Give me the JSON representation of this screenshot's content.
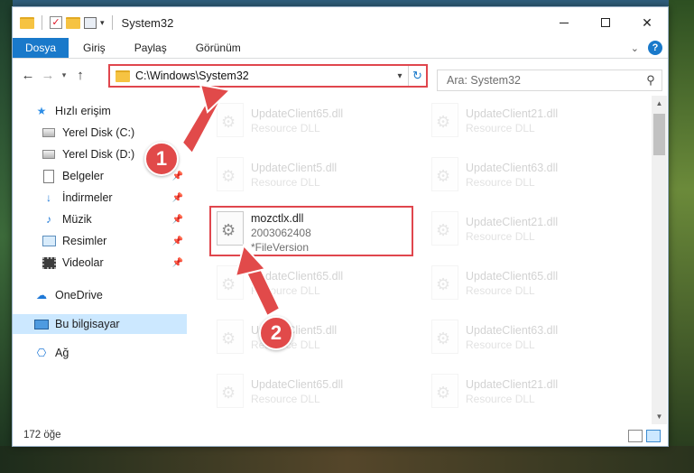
{
  "window": {
    "title": "System32",
    "minimize_label": "",
    "close_glyph": "✕"
  },
  "ribbon": {
    "tabs": [
      "Dosya",
      "Giriş",
      "Paylaş",
      "Görünüm"
    ],
    "help_glyph": "?",
    "expand_glyph": "⌄"
  },
  "address": {
    "path": "C:\\Windows\\System32",
    "refresh_glyph": "↻",
    "search_placeholder": "Ara: System32"
  },
  "nav_pane": {
    "items": [
      {
        "label": "Hızlı erişim",
        "icon": "star-icon"
      },
      {
        "label": "Yerel Disk (C:)",
        "icon": "disk-icon"
      },
      {
        "label": "Yerel Disk (D:)",
        "icon": "disk-icon"
      },
      {
        "label": "Belgeler",
        "icon": "document-icon"
      },
      {
        "label": "İndirmeler",
        "icon": "download-icon"
      },
      {
        "label": "Müzik",
        "icon": "music-icon"
      },
      {
        "label": "Resimler",
        "icon": "pictures-icon"
      },
      {
        "label": "Videolar",
        "icon": "video-icon"
      },
      {
        "label": "OneDrive",
        "icon": "cloud-icon"
      },
      {
        "label": "Bu bilgisayar",
        "icon": "computer-icon"
      },
      {
        "label": "Ağ",
        "icon": "network-icon"
      }
    ]
  },
  "files": {
    "col1": [
      {
        "name": "UpdateClient65.dll",
        "sub": "Resource DLL"
      },
      {
        "name": "UpdateClient5.dll",
        "sub": "Resource DLL"
      },
      {
        "name": "mozctlx.dll",
        "sub": "2003062408",
        "sub2": "*FileVersion"
      },
      {
        "name": "UpdateClient65.dll",
        "sub": "Resource DLL"
      },
      {
        "name": "UpdateClient5.dll",
        "sub": "Resource DLL"
      },
      {
        "name": "UpdateClient65.dll",
        "sub": "Resource DLL"
      }
    ],
    "col2": [
      {
        "name": "UpdateClient21.dll",
        "sub": "Resource DLL"
      },
      {
        "name": "UpdateClient63.dll",
        "sub": "Resource DLL"
      },
      {
        "name": "UpdateClient21.dll",
        "sub": "Resource DLL"
      },
      {
        "name": "UpdateClient65.dll",
        "sub": "Resource DLL"
      },
      {
        "name": "UpdateClient63.dll",
        "sub": "Resource DLL"
      },
      {
        "name": "UpdateClient21.dll",
        "sub": "Resource DLL"
      }
    ]
  },
  "status": {
    "item_count": "172 öğe"
  },
  "annotations": {
    "step1": "1",
    "step2": "2",
    "color": "#e14a4a"
  }
}
